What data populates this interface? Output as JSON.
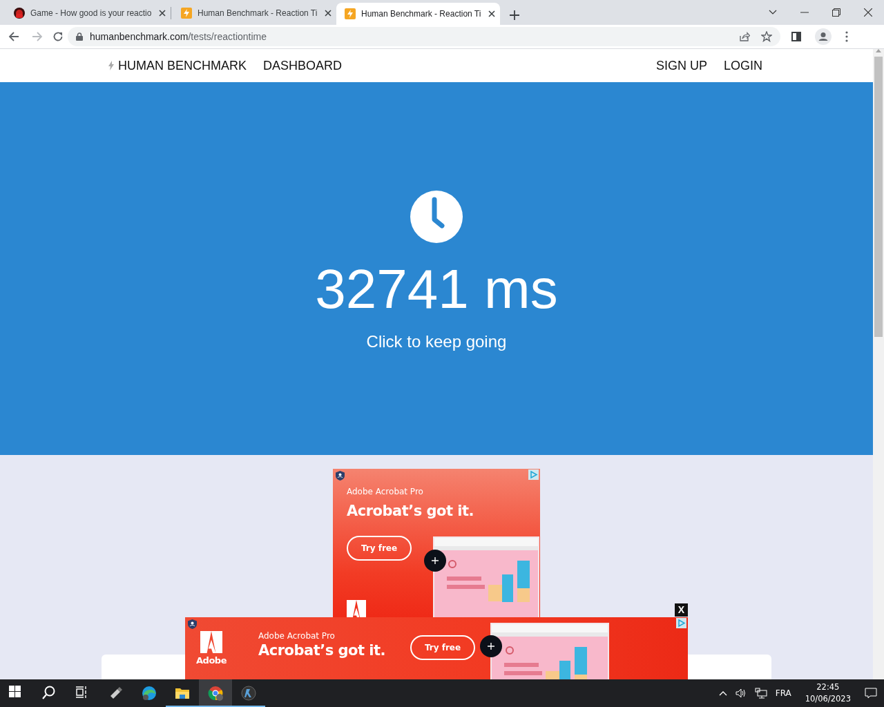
{
  "browser": {
    "tabs": [
      {
        "title": "Game - How good is your reactio",
        "kind": "game",
        "selected": false
      },
      {
        "title": "Human Benchmark - Reaction Ti",
        "kind": "bolt",
        "selected": false
      },
      {
        "title": "Human Benchmark - Reaction Ti",
        "kind": "bolt",
        "selected": true
      }
    ],
    "url": {
      "host": "humanbenchmark.com",
      "path": "/tests/reactiontime"
    }
  },
  "nav": {
    "brand": "HUMAN BENCHMARK",
    "links": [
      "DASHBOARD"
    ],
    "right_links": [
      "SIGN UP",
      "LOGIN"
    ]
  },
  "test": {
    "result": "32741 ms",
    "prompt": "Click to keep going"
  },
  "ads": [
    {
      "kind": "box",
      "product": "Adobe Acrobat Pro",
      "headline": "Acrobat’s got it.",
      "button": "Try free"
    },
    {
      "kind": "banner",
      "product": "Adobe Acrobat Pro",
      "headline": "Acrobat’s got it.",
      "button": "Try free",
      "logo_text": "Adobe",
      "close": "X"
    }
  ],
  "taskbar": {
    "apps": [
      {
        "kind": "start",
        "running": false,
        "selected": false
      },
      {
        "kind": "search",
        "running": false,
        "selected": false
      },
      {
        "kind": "taskview",
        "running": false,
        "selected": false
      },
      {
        "kind": "usb",
        "running": false,
        "selected": false
      },
      {
        "kind": "edge",
        "running": false,
        "selected": false
      },
      {
        "kind": "explorer",
        "running": true,
        "selected": false
      },
      {
        "kind": "chrome",
        "running": true,
        "selected": true
      },
      {
        "kind": "game",
        "running": true,
        "selected": false
      }
    ],
    "language": "FRA",
    "time": "22:45",
    "date": "10/06/2023"
  }
}
